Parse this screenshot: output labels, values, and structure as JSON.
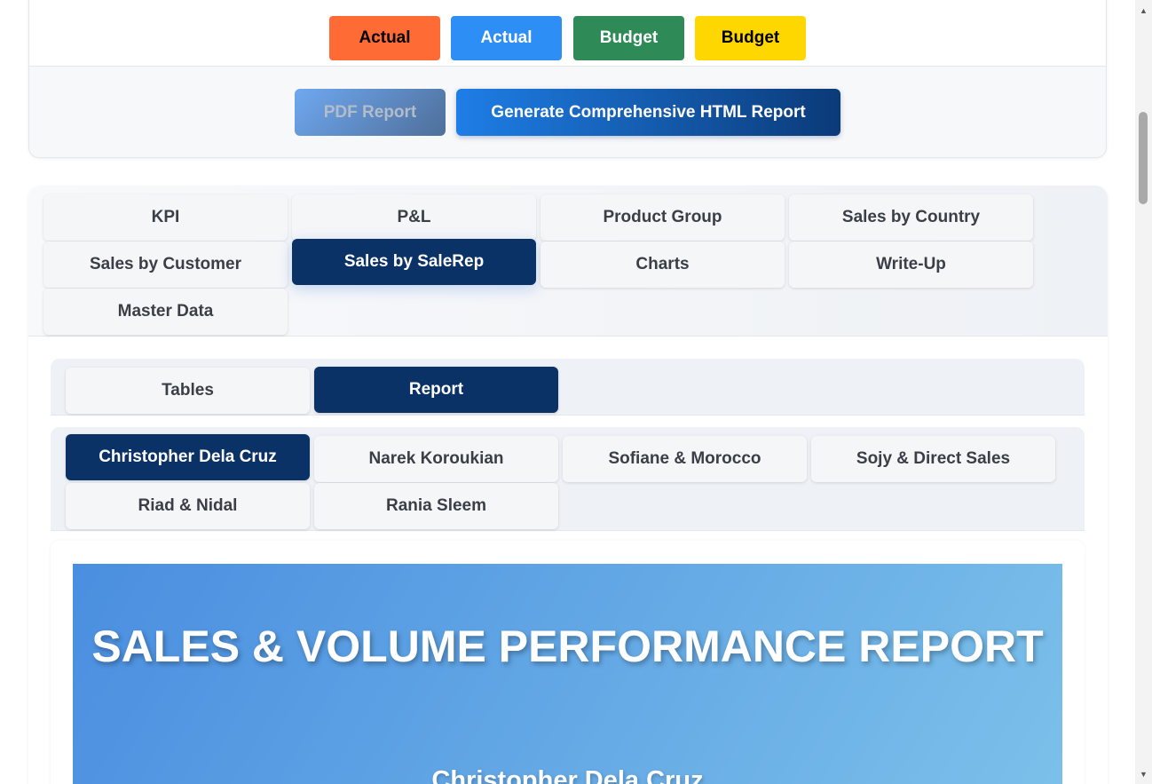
{
  "legend": {
    "row_top": [
      {
        "label": "",
        "bg": "#ff6b35",
        "color": "#000000"
      },
      {
        "label": "",
        "bg": "#2d8ff5",
        "color": "#ffffff"
      },
      {
        "label": "",
        "bg": "#2e8b57",
        "color": "#ffffff"
      },
      {
        "label": "",
        "bg": "#ffd700",
        "color": "#000000"
      }
    ],
    "row_bottom": [
      {
        "label": "Actual",
        "bg": "#ff6b35",
        "color": "#000000"
      },
      {
        "label": "Actual",
        "bg": "#2d8ff5",
        "color": "#ffffff"
      },
      {
        "label": "Budget",
        "bg": "#2e8b57",
        "color": "#ffffff"
      },
      {
        "label": "Budget",
        "bg": "#ffd700",
        "color": "#000000"
      }
    ]
  },
  "actions": {
    "pdf_label": "PDF Report",
    "html_label": "Generate Comprehensive HTML Report"
  },
  "main_tabs": [
    {
      "label": "KPI",
      "active": false
    },
    {
      "label": "P&L",
      "active": false
    },
    {
      "label": "Product Group",
      "active": false
    },
    {
      "label": "Sales by Country",
      "active": false
    },
    {
      "label": "Sales by Customer",
      "active": false
    },
    {
      "label": "Sales by SaleRep",
      "active": true
    },
    {
      "label": "Charts",
      "active": false
    },
    {
      "label": "Write-Up",
      "active": false
    },
    {
      "label": "Master Data",
      "active": false
    }
  ],
  "view_tabs": [
    {
      "label": "Tables",
      "active": false
    },
    {
      "label": "Report",
      "active": true
    }
  ],
  "rep_tabs": [
    {
      "label": "Christopher Dela Cruz",
      "active": true
    },
    {
      "label": "Narek Koroukian",
      "active": false
    },
    {
      "label": "Sofiane & Morocco",
      "active": false
    },
    {
      "label": "Sojy & Direct Sales",
      "active": false
    },
    {
      "label": "Riad & Nidal",
      "active": false
    },
    {
      "label": "Rania Sleem",
      "active": false
    }
  ],
  "report": {
    "title": "SALES & VOLUME PERFORMANCE REPORT",
    "subtitle": "Christopher Dela Cruz"
  },
  "scrollbar": {
    "up_icon": "triangle-up",
    "down_icon": "triangle-down"
  }
}
